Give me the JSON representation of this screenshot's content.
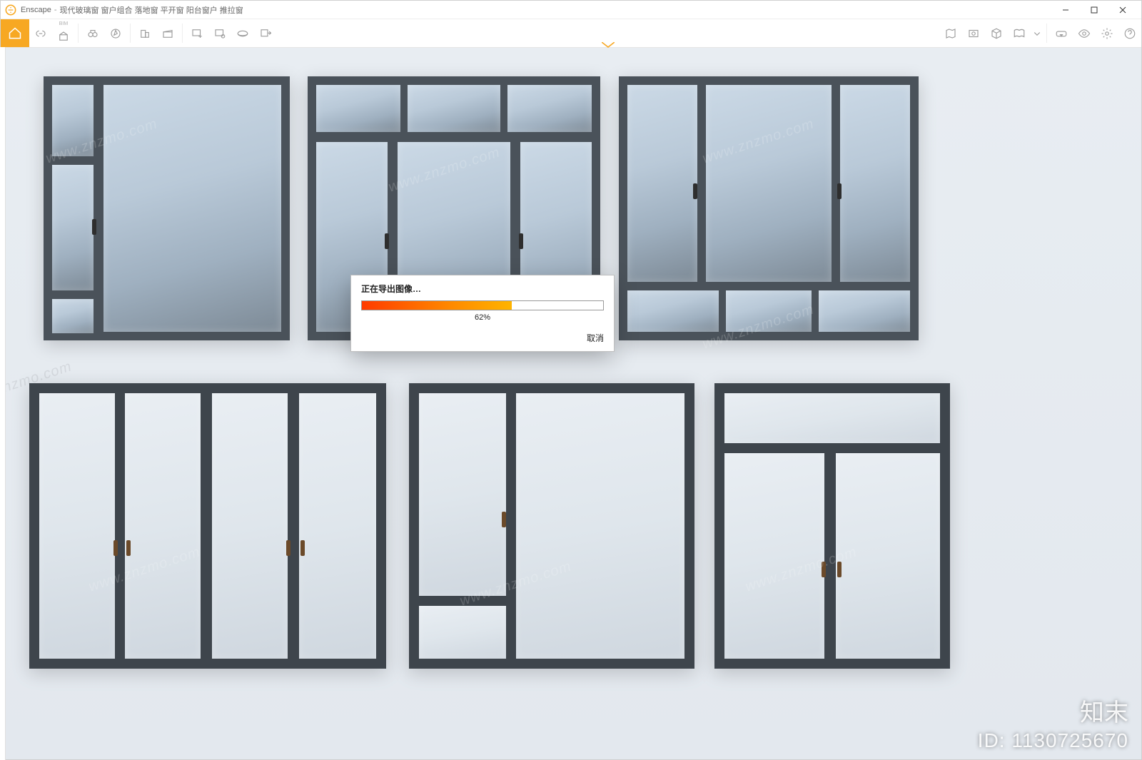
{
  "app": {
    "name": "Enscape",
    "document_title": "现代玻璃窗 窗户组合 落地窗 平开窗 阳台窗户 推拉窗"
  },
  "window_controls": {
    "minimize": "–",
    "maximize": "□",
    "close": "×"
  },
  "toolbar": {
    "home": "home-icon",
    "bim_label": "BIM",
    "left_icons": [
      "link-icon",
      "bim-icon",
      "binoculars-icon",
      "compass-icon",
      "building-icon",
      "clapper-icon",
      "favorite-view-add-icon",
      "favorite-view-manage-icon",
      "pano-360-icon",
      "export-icon"
    ],
    "right_icons": [
      "map-icon",
      "screenshot-icon",
      "cube-icon",
      "open-book-icon",
      "down-caret-icon",
      "vr-headset-icon",
      "eye-icon",
      "gear-icon",
      "help-icon"
    ]
  },
  "dialog": {
    "title": "正在导出图像…",
    "percent_label": "62%",
    "percent_value": 62,
    "cancel": "取消"
  },
  "watermark": {
    "id_label": "ID: 1130725670",
    "brand": "知末",
    "diag_text": "www.znzmo.com"
  },
  "colors": {
    "accent": "#f7a823",
    "frame": "#4a525a",
    "frame_dark": "#3e454c",
    "progress_start": "#ff3b00",
    "progress_end": "#ffb400"
  }
}
